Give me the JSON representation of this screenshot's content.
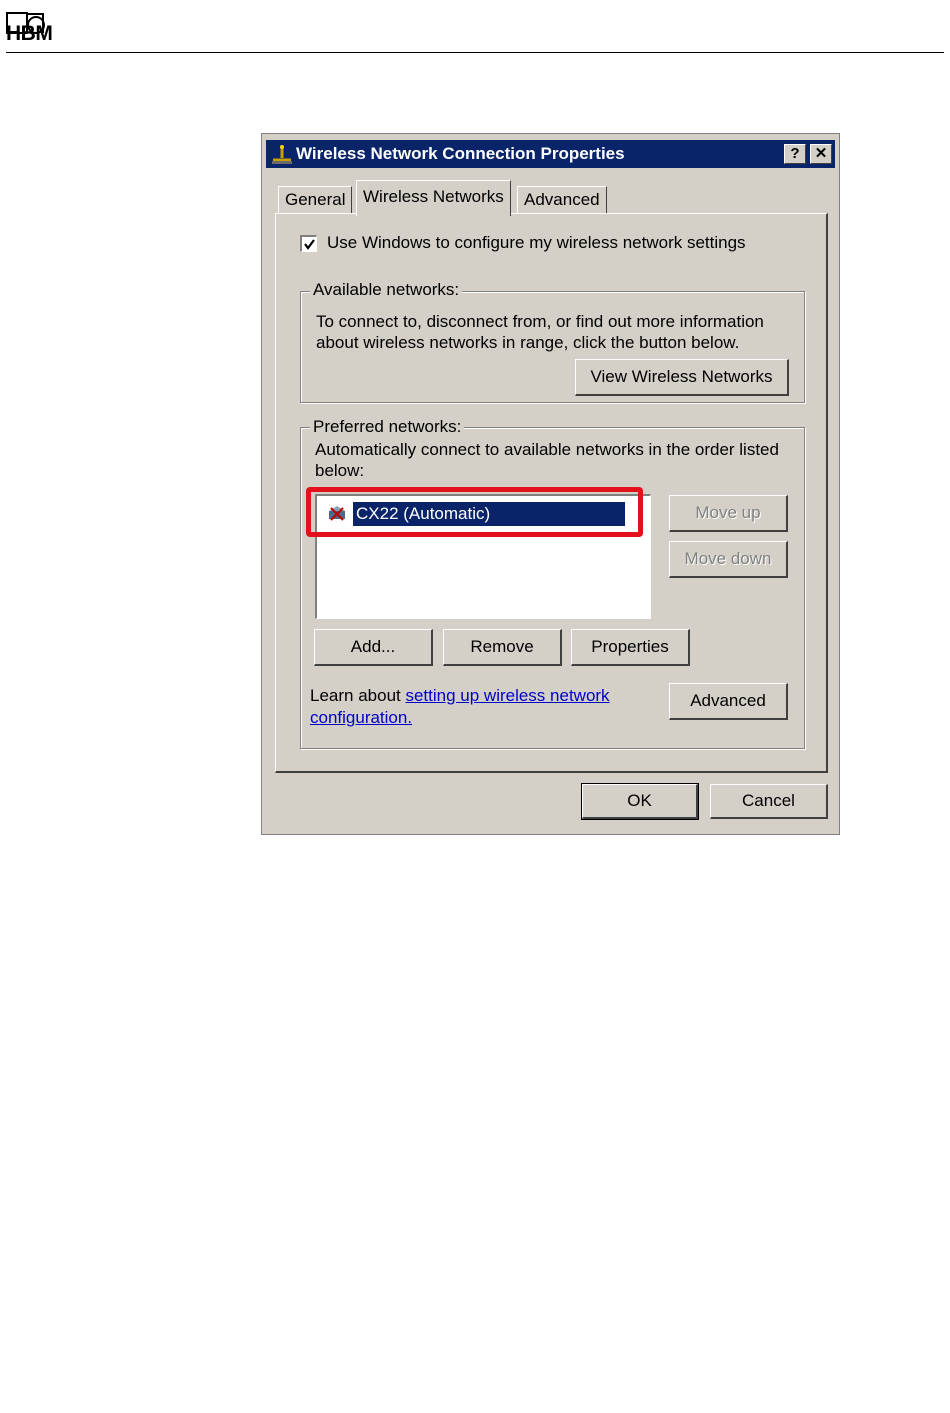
{
  "header": {
    "logo_text": "HBM"
  },
  "dialog": {
    "title": "Wireless Network Connection Properties",
    "help_label": "?",
    "close_label": "✕",
    "tabs": [
      {
        "label": "General",
        "selected": false
      },
      {
        "label": "Wireless Networks",
        "selected": true
      },
      {
        "label": "Advanced",
        "selected": false
      }
    ],
    "use_windows_checkbox": {
      "label": "Use Windows to configure my wireless network settings",
      "checked": true
    },
    "available": {
      "legend": "Available networks:",
      "line1": "To connect to, disconnect from, or find out more information",
      "line2": "about wireless networks in range, click the button below.",
      "view_button": "View Wireless Networks"
    },
    "preferred": {
      "legend": "Preferred networks:",
      "line1": "Automatically connect to available networks in the order listed",
      "line2": "below:",
      "networks": [
        {
          "name": "CX22 (Automatic)",
          "selected": true,
          "icon": "wireless-network-icon"
        }
      ],
      "move_up": "Move up",
      "move_down": "Move down",
      "add": "Add...",
      "remove": "Remove",
      "properties": "Properties",
      "learn_prefix": "Learn about ",
      "learn_link_1": "setting up wireless network",
      "learn_link_2": "configuration.",
      "advanced_button": "Advanced"
    },
    "ok": "OK",
    "cancel": "Cancel"
  },
  "colors": {
    "titlebar": "#0a246a",
    "selection": "#0a246a",
    "highlight_box": "#e3111b",
    "dialog_face": "#d4d0c8",
    "link": "#0000cc"
  }
}
